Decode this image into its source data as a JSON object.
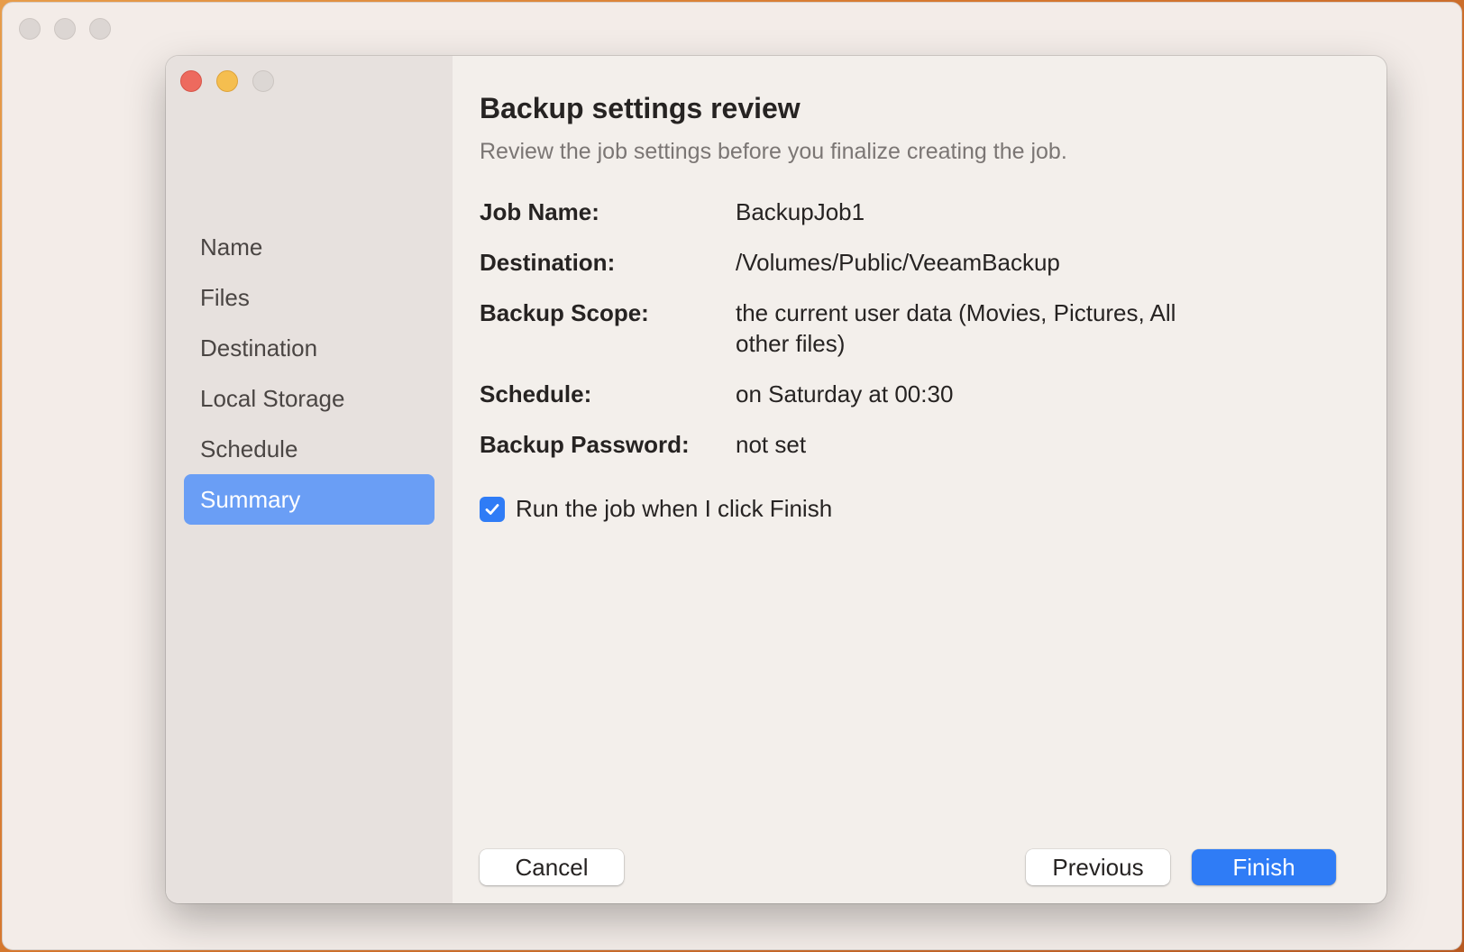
{
  "window": {
    "dialog_title": "Backup settings review",
    "subtitle": "Review the job settings before you finalize creating the job."
  },
  "sidebar": {
    "items": [
      {
        "label": "Name",
        "active": false
      },
      {
        "label": "Files",
        "active": false
      },
      {
        "label": "Destination",
        "active": false
      },
      {
        "label": "Local Storage",
        "active": false
      },
      {
        "label": "Schedule",
        "active": false
      },
      {
        "label": "Summary",
        "active": true
      }
    ]
  },
  "summary": {
    "job_name_label": "Job Name:",
    "job_name_value": "BackupJob1",
    "destination_label": "Destination:",
    "destination_value": "/Volumes/Public/VeeamBackup",
    "scope_label": "Backup Scope:",
    "scope_value": "the current user data (Movies, Pictures, All other files)",
    "schedule_label": "Schedule:",
    "schedule_value": "on Saturday at 00:30",
    "password_label": "Backup Password:",
    "password_value": "not set"
  },
  "options": {
    "run_on_finish_label": "Run the job when I click Finish",
    "run_on_finish_checked": true
  },
  "buttons": {
    "cancel": "Cancel",
    "previous": "Previous",
    "finish": "Finish"
  },
  "colors": {
    "accent": "#2f7cf6",
    "sidebar_selection": "#6a9ef5",
    "close": "#ed6a5e",
    "minimize": "#f5be4f"
  }
}
